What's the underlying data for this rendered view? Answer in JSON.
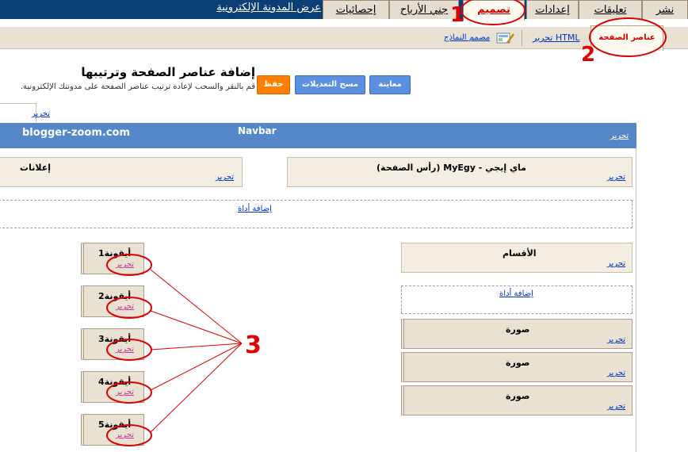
{
  "top_tabs": {
    "publish": "نشر",
    "comments": "تعليقات",
    "settings": "إعدادات",
    "design": "تصميم",
    "earnings": "جني الأرباح",
    "stats": "إحصائيات",
    "view_blog": "عرض المدونة الإلكترونية"
  },
  "sub_tabs": {
    "page_elements": "عناصر الصفحة",
    "edit_html": "تحرير HTML",
    "template_designer": "مصمم النماذج"
  },
  "heading": {
    "title": "إضافة عناصر الصفحة وترتيبها",
    "subtitle": "قم بالنقر والسحب لإعادة ترتيب عناصر الصفحة على مدونتك الإلكترونية."
  },
  "buttons": {
    "preview": "معاينة",
    "clear_edits": "مسح التعديلات",
    "save": "حفظ"
  },
  "layout": {
    "edit": "تحرير",
    "add_gadget": "إضافة أداة",
    "navbar_title": "Navbar",
    "navbar_site": "blogger-zoom.com",
    "header_title": "ماي إيجي - MyEgy (رأس الصفحة)",
    "ads_title": "إعلانات",
    "labels_title": "الأقسام",
    "image_title": "صورة",
    "tricks": [
      "أيقونة1",
      "أيقونة2",
      "أيقونة3",
      "أيقونة4",
      "أيقونة5"
    ]
  },
  "annotations": {
    "n1": "1",
    "n2": "2",
    "n3": "3"
  },
  "colors": {
    "top_bar": "#0a3f73",
    "tab_bg": "#e5ddd0",
    "sub_bar": "#e9e1d4",
    "navbar_blue": "#5588c8",
    "annotation_red": "#e00000",
    "button_blue": "#5b8fe0",
    "button_orange": "#ff8000"
  }
}
